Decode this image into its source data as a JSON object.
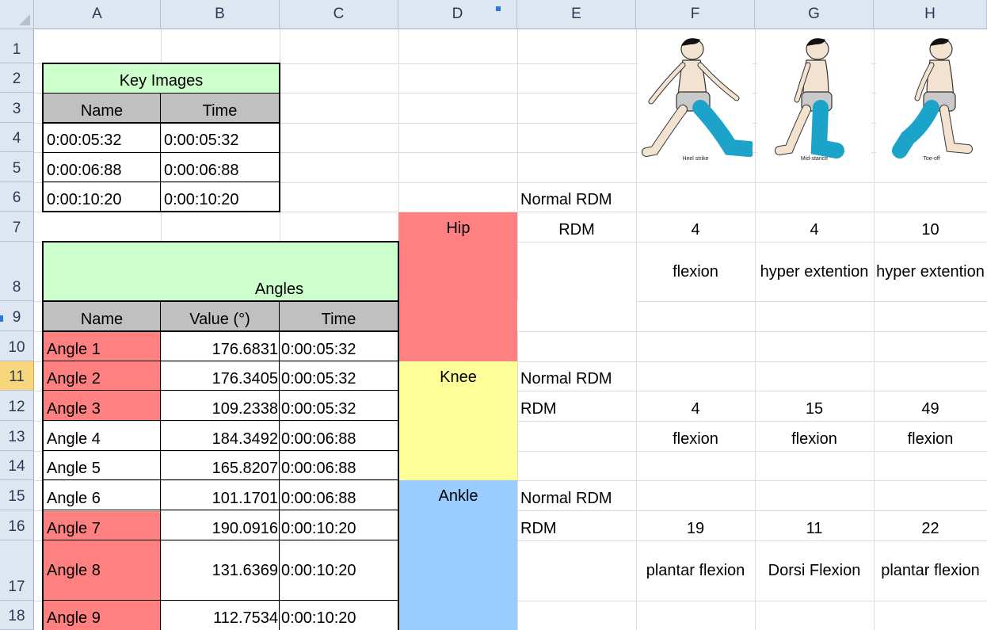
{
  "columns": [
    "A",
    "B",
    "C",
    "D",
    "E",
    "F",
    "G",
    "H"
  ],
  "rows": [
    "1",
    "2",
    "3",
    "4",
    "5",
    "6",
    "7",
    "8",
    "9",
    "10",
    "11",
    "12",
    "13",
    "14",
    "15",
    "16",
    "17",
    "18"
  ],
  "selected_row": "11",
  "colors": {
    "header_bg": "#dde6f1",
    "green": "#ccffcc",
    "gray": "#c0c0c0",
    "red": "#ff8080",
    "yellow": "#ffff99",
    "blue": "#99ccff",
    "leg": "#1ba3c9"
  },
  "key_images": {
    "title": "Key Images",
    "col_name": "Name",
    "col_time": "Time",
    "rows": [
      {
        "name": "0:00:05:32",
        "time": "0:00:05:32"
      },
      {
        "name": "0:00:06:88",
        "time": "0:00:06:88"
      },
      {
        "name": "0:00:10:20",
        "time": "0:00:10:20"
      }
    ]
  },
  "angles": {
    "title": "Angles",
    "col_name": "Name",
    "col_value": "Value (°)",
    "col_time": "Time",
    "rows": [
      {
        "name": "Angle 1",
        "value": "176.6831",
        "time": "0:00:05:32",
        "highlight": true
      },
      {
        "name": "Angle 2",
        "value": "176.3405",
        "time": "0:00:05:32",
        "highlight": true
      },
      {
        "name": "Angle 3",
        "value": "109.2338",
        "time": "0:00:05:32",
        "highlight": true
      },
      {
        "name": "Angle 4",
        "value": "184.3492",
        "time": "0:00:06:88",
        "highlight": false
      },
      {
        "name": "Angle 5",
        "value": "165.8207",
        "time": "0:00:06:88",
        "highlight": false
      },
      {
        "name": "Angle 6",
        "value": "101.1701",
        "time": "0:00:06:88",
        "highlight": false
      },
      {
        "name": "Angle 7",
        "value": "190.0916",
        "time": "0:00:10:20",
        "highlight": true
      },
      {
        "name": "Angle 8",
        "value": "131.6369",
        "time": "0:00:10:20",
        "highlight": true
      },
      {
        "name": "Angle 9",
        "value": "112.7534",
        "time": "0:00:10:20",
        "highlight": true
      }
    ]
  },
  "gait_images": [
    {
      "caption": "Heel strike"
    },
    {
      "caption": "Mid-stance"
    },
    {
      "caption": "Toe-off"
    }
  ],
  "rdm": {
    "normal_label": "Normal RDM",
    "rdm_label": "RDM",
    "hip": {
      "label": "Hip",
      "values": [
        "4",
        "4",
        "10"
      ],
      "motion": [
        "flexion",
        "hyper extention",
        "hyper extention"
      ]
    },
    "knee": {
      "label": "Knee",
      "values": [
        "4",
        "15",
        "49"
      ],
      "motion": [
        "flexion",
        "flexion",
        "flexion"
      ]
    },
    "ankle": {
      "label": "Ankle",
      "values": [
        "19",
        "11",
        "22"
      ],
      "motion": [
        "plantar flexion",
        "Dorsi Flexion",
        "plantar flexion"
      ]
    }
  }
}
